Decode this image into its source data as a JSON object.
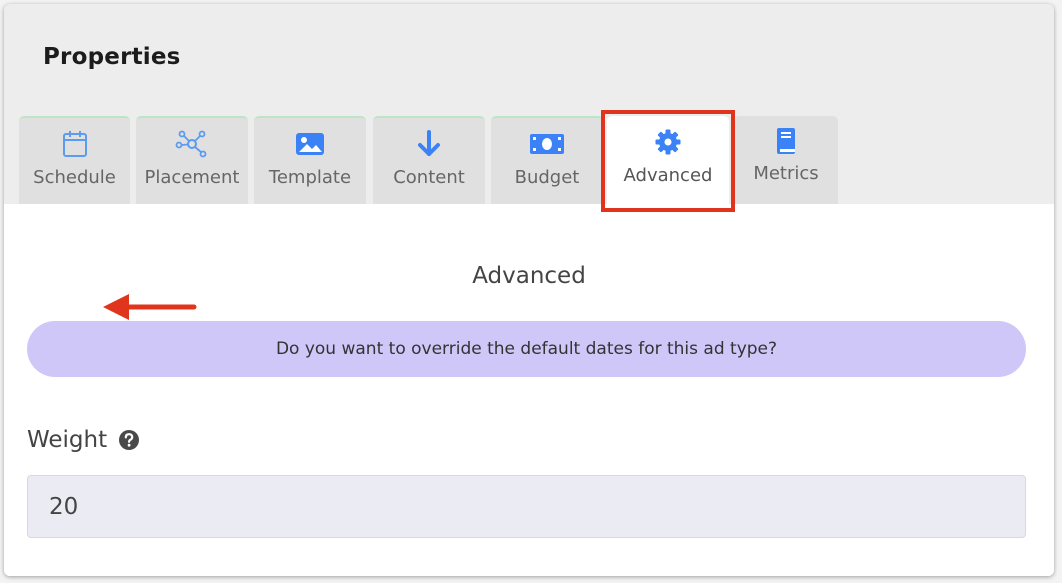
{
  "header": {
    "title": "Properties"
  },
  "tabs": [
    {
      "id": "schedule",
      "label": "Schedule",
      "icon": "calendar-icon"
    },
    {
      "id": "placement",
      "label": "Placement",
      "icon": "network-icon"
    },
    {
      "id": "template",
      "label": "Template",
      "icon": "image-icon"
    },
    {
      "id": "content",
      "label": "Content",
      "icon": "arrow-down-icon"
    },
    {
      "id": "budget",
      "label": "Budget",
      "icon": "money-icon"
    },
    {
      "id": "advanced",
      "label": "Advanced",
      "icon": "gear-icon",
      "active": true
    },
    {
      "id": "metrics",
      "label": "Metrics",
      "icon": "book-icon"
    }
  ],
  "panel": {
    "title": "Advanced",
    "banner_text": "Do you want to override the default dates for this ad type?",
    "weight": {
      "label": "Weight",
      "value": "20"
    }
  },
  "colors": {
    "accent_blue": "#3b82f6",
    "banner_bg": "#cfc7f8",
    "highlight_red": "#e0341c",
    "tab_border_green": "#bde4c7"
  }
}
